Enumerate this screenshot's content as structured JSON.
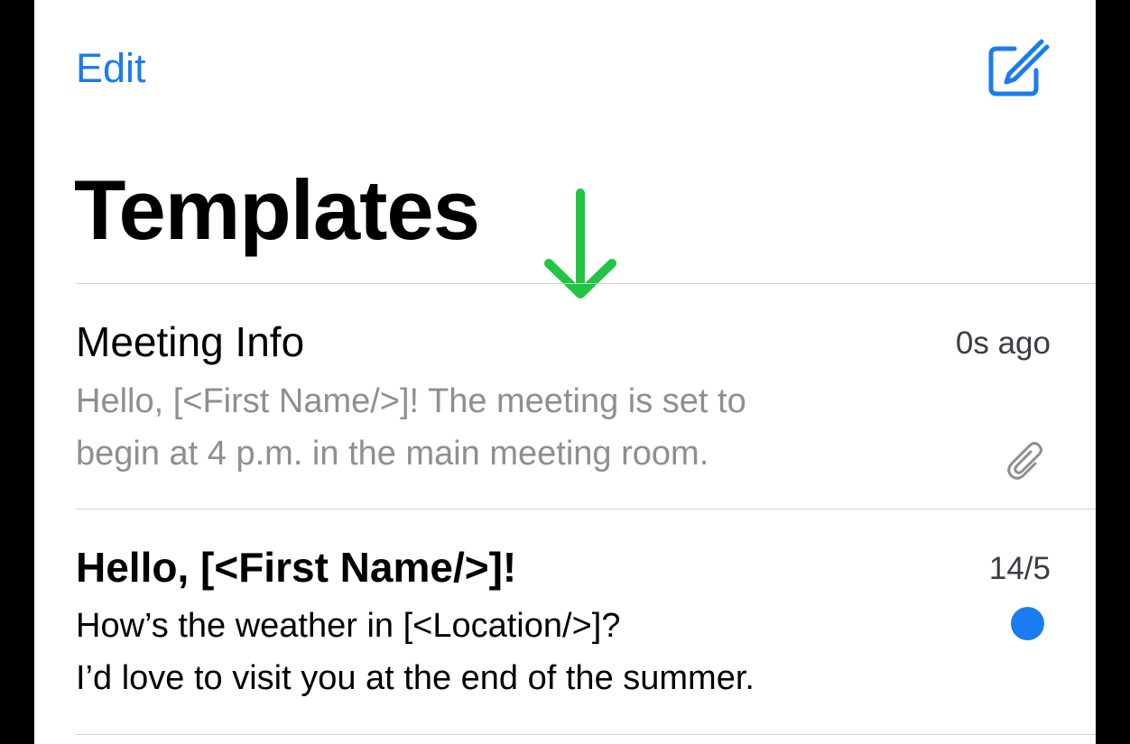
{
  "nav": {
    "edit_label": "Edit",
    "compose_icon": "compose-icon"
  },
  "page": {
    "title": "Templates"
  },
  "indicator": {
    "icon": "arrow-down-icon",
    "color": "#22c443"
  },
  "templates": [
    {
      "title": "Meeting Info",
      "time": "0s ago",
      "preview_line1": "Hello, [<First Name/>]! The meeting is set to",
      "preview_line2": "begin at 4 p.m. in the main meeting room.",
      "unread": false,
      "has_attachment": true,
      "attachment_icon": "paperclip-icon"
    },
    {
      "title": "Hello, [<First Name/>]!",
      "time": "14/5",
      "preview_line1": "How’s the weather in [<Location/>]?",
      "preview_line2": "I’d love to visit you at the end of the summer.",
      "unread": true,
      "has_attachment": false,
      "status_icon": "unread-dot-icon"
    }
  ],
  "colors": {
    "accent": "#1a7cf0",
    "secondary_text": "#8e8e93",
    "separator": "#d2d2d6"
  }
}
